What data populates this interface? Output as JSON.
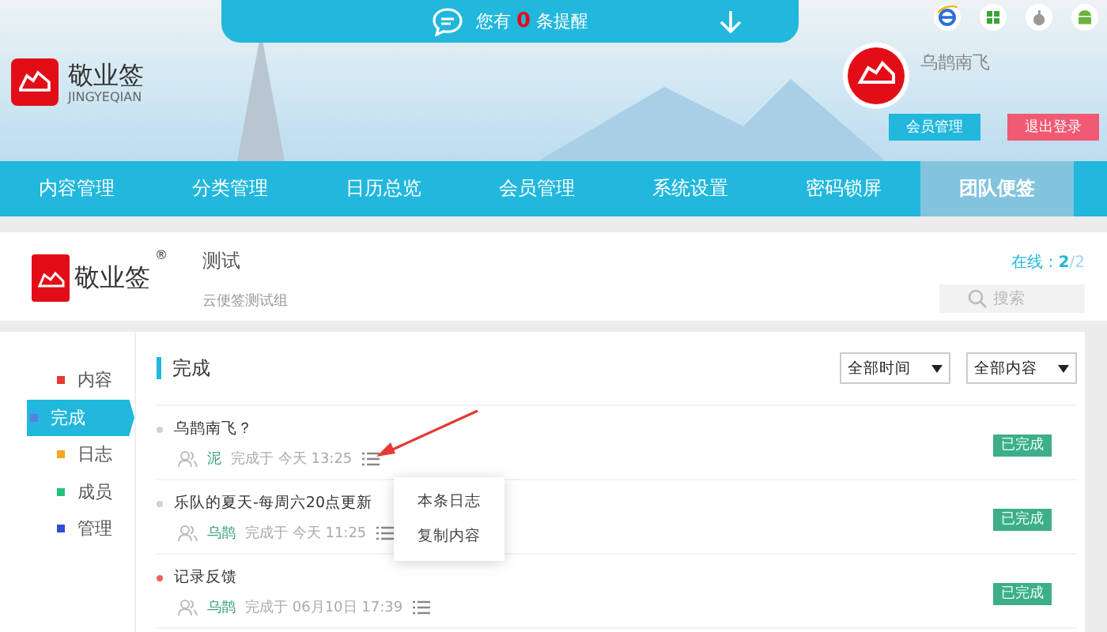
{
  "notice": {
    "prefix": "您有",
    "count": "0",
    "suffix": "条提醒"
  },
  "brand": {
    "name": "敬业签",
    "pinyin": "JINGYEQIAN"
  },
  "user": {
    "name": "乌鹊南飞"
  },
  "header_buttons": [
    {
      "label": "会员管理",
      "kind": "primary"
    },
    {
      "label": "退出登录",
      "kind": "danger"
    }
  ],
  "nav": [
    {
      "label": "内容管理",
      "selected": false
    },
    {
      "label": "分类管理",
      "selected": false
    },
    {
      "label": "日历总览",
      "selected": false
    },
    {
      "label": "会员管理",
      "selected": false
    },
    {
      "label": "系统设置",
      "selected": false
    },
    {
      "label": "密码锁屏",
      "selected": false
    },
    {
      "label": "团队便签",
      "selected": true
    }
  ],
  "group": {
    "brand": "敬业签",
    "mark": "®",
    "name": "测试",
    "description": "云便签测试组",
    "online_label": "在线：",
    "online": "2",
    "total": "/2",
    "search_placeholder": "搜索"
  },
  "sidebar": [
    {
      "label": "内容",
      "color": "#e53935",
      "selected": false
    },
    {
      "label": "完成",
      "color": "#5b7be8",
      "selected": true
    },
    {
      "label": "日志",
      "color": "#f5a623",
      "selected": false
    },
    {
      "label": "成员",
      "color": "#1fc47a",
      "selected": false
    },
    {
      "label": "管理",
      "color": "#2e4fd1",
      "selected": false
    }
  ],
  "section_title": "完成",
  "filters": [
    "全部时间",
    "全部内容"
  ],
  "tasks": [
    {
      "title": "乌鹊南飞？",
      "color": "#d0d0d0",
      "user": "泥",
      "meta": "完成于 今天 13:25",
      "status": "已完成"
    },
    {
      "title": "乐队的夏天-每周六20点更新",
      "color": "#d0d0d0",
      "user": "乌鹊",
      "meta": "完成于 今天 11:25",
      "status": "已完成"
    },
    {
      "title": "记录反馈",
      "color": "#f06060",
      "user": "乌鹊",
      "meta": "完成于 06月10日 17:39",
      "status": "已完成"
    }
  ],
  "context_menu": [
    "本条日志",
    "复制内容"
  ]
}
